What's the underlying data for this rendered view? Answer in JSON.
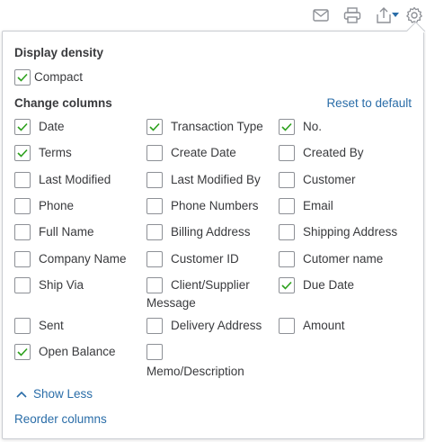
{
  "toolbar": {
    "icons": [
      "mail-icon",
      "print-icon",
      "export-icon",
      "gear-icon"
    ]
  },
  "density": {
    "title": "Display density",
    "option": {
      "label": "Compact",
      "checked": true
    }
  },
  "columns": {
    "title": "Change columns",
    "reset_label": "Reset to default",
    "items": [
      {
        "label": "Date",
        "checked": true
      },
      {
        "label": "Transaction Type",
        "checked": true
      },
      {
        "label": "No.",
        "checked": true
      },
      {
        "label": "Terms",
        "checked": true
      },
      {
        "label": "Create Date",
        "checked": false
      },
      {
        "label": "Created By",
        "checked": false
      },
      {
        "label": "Last Modified",
        "checked": false
      },
      {
        "label": "Last Modified By",
        "checked": false
      },
      {
        "label": "Customer",
        "checked": false
      },
      {
        "label": "Phone",
        "checked": false
      },
      {
        "label": "Phone Numbers",
        "checked": false
      },
      {
        "label": "Email",
        "checked": false
      },
      {
        "label": "Full Name",
        "checked": false
      },
      {
        "label": "Billing Address",
        "checked": false
      },
      {
        "label": "Shipping Address",
        "checked": false
      },
      {
        "label": "Company Name",
        "checked": false
      },
      {
        "label": "Customer ID",
        "checked": false
      },
      {
        "label": "Cutomer name",
        "checked": false
      },
      {
        "label": "Ship Via",
        "checked": false
      },
      {
        "label": "Client/Supplier",
        "label2": "Message",
        "checked": false
      },
      {
        "label": "Due Date",
        "checked": true
      },
      {
        "label": "Sent",
        "checked": false
      },
      {
        "label": "Delivery Address",
        "checked": false
      },
      {
        "label": "Amount",
        "checked": false
      },
      {
        "label": "Open Balance",
        "checked": true
      },
      {
        "label": "",
        "label2": "Memo/Description",
        "checked": false
      }
    ]
  },
  "footer": {
    "show_less_label": "Show Less",
    "reorder_label": "Reorder columns"
  },
  "colors": {
    "link": "#2a6da8",
    "check": "#2ca01c",
    "text": "#393a3d",
    "border": "#8d9096"
  }
}
